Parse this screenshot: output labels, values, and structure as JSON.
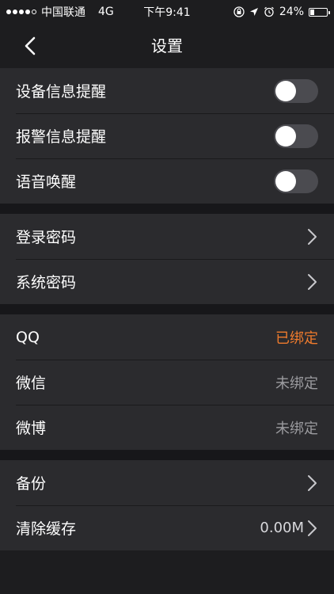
{
  "status_bar": {
    "carrier": "中国联通",
    "network": "4G",
    "time": "下午9:41",
    "battery_percent_text": "24%",
    "battery_level": 0.24
  },
  "nav": {
    "title": "设置",
    "back_icon": "chevron-left-icon"
  },
  "groups": {
    "notifications": [
      {
        "label": "设备信息提醒",
        "toggle_on": false
      },
      {
        "label": "报警信息提醒",
        "toggle_on": false
      },
      {
        "label": "语音唤醒",
        "toggle_on": false
      }
    ],
    "passwords": [
      {
        "label": "登录密码"
      },
      {
        "label": "系统密码"
      }
    ],
    "accounts": [
      {
        "label": "QQ",
        "status": "已绑定"
      },
      {
        "label": "微信",
        "status": "未绑定"
      },
      {
        "label": "微博",
        "status": "未绑定"
      }
    ],
    "storage": [
      {
        "label": "备份"
      },
      {
        "label": "清除缓存",
        "value": "0.00M"
      }
    ]
  },
  "colors": {
    "background": "#1d1d1f",
    "row_background": "#2b2b2e",
    "accent_bound": "#f07b2d",
    "unbound": "#9b9b9f"
  }
}
